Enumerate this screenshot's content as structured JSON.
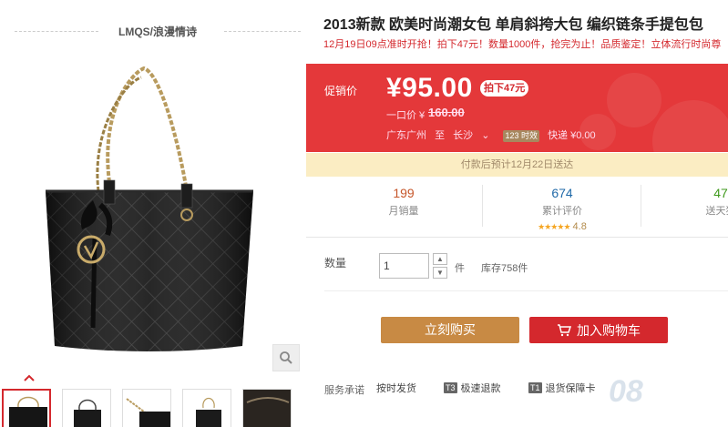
{
  "shop": {
    "name": "LMQS/浪漫情诗"
  },
  "gallery": {
    "main_image_alt": "黑色菱格纹链条手提包",
    "thumbnail_count": 5
  },
  "product": {
    "title": "2013新款 欧美时尚潮女包 单肩斜挎大包 编织链条手提包包",
    "subtitle": "12月19日09点准时开抢！拍下47元！数量1000件，抢完为止！品质鉴定！立体流行时尚尊"
  },
  "price": {
    "label": "促销价",
    "current": "¥95.00",
    "badge": "拍下47元",
    "original_label": "一口价 ¥",
    "original": "160.00",
    "ship_from": "广东广州",
    "ship_to_word": "至",
    "ship_to": "长沙",
    "ship_tag": "123 时效",
    "delivery_fee": "快递 ¥0.00"
  },
  "delivery_note": "付款后预计12月22日送达",
  "stats": {
    "sales": {
      "value": "199",
      "label": "月销量"
    },
    "reviews": {
      "value": "674",
      "label": "累计评价",
      "stars": "★★★★★",
      "rating": "4.8"
    },
    "points": {
      "value": "47",
      "label": "送天猫"
    }
  },
  "quantity": {
    "label": "数量",
    "value": "1",
    "unit": "件",
    "stock": "库存758件"
  },
  "buttons": {
    "buy_now": "立刻购买",
    "add_to_cart": "加入购物车"
  },
  "service": {
    "label": "服务承诺",
    "items": [
      {
        "tag": "",
        "text": "按时发货"
      },
      {
        "tag": "T3",
        "text": "极速退款"
      },
      {
        "tag": "T1",
        "text": "退货保障卡"
      }
    ]
  },
  "watermark": "08",
  "colors": {
    "accent_red": "#e4383a",
    "buy_button": "#c88a44",
    "cart_button": "#d4282d",
    "delivery_bg": "#fbedc3"
  }
}
